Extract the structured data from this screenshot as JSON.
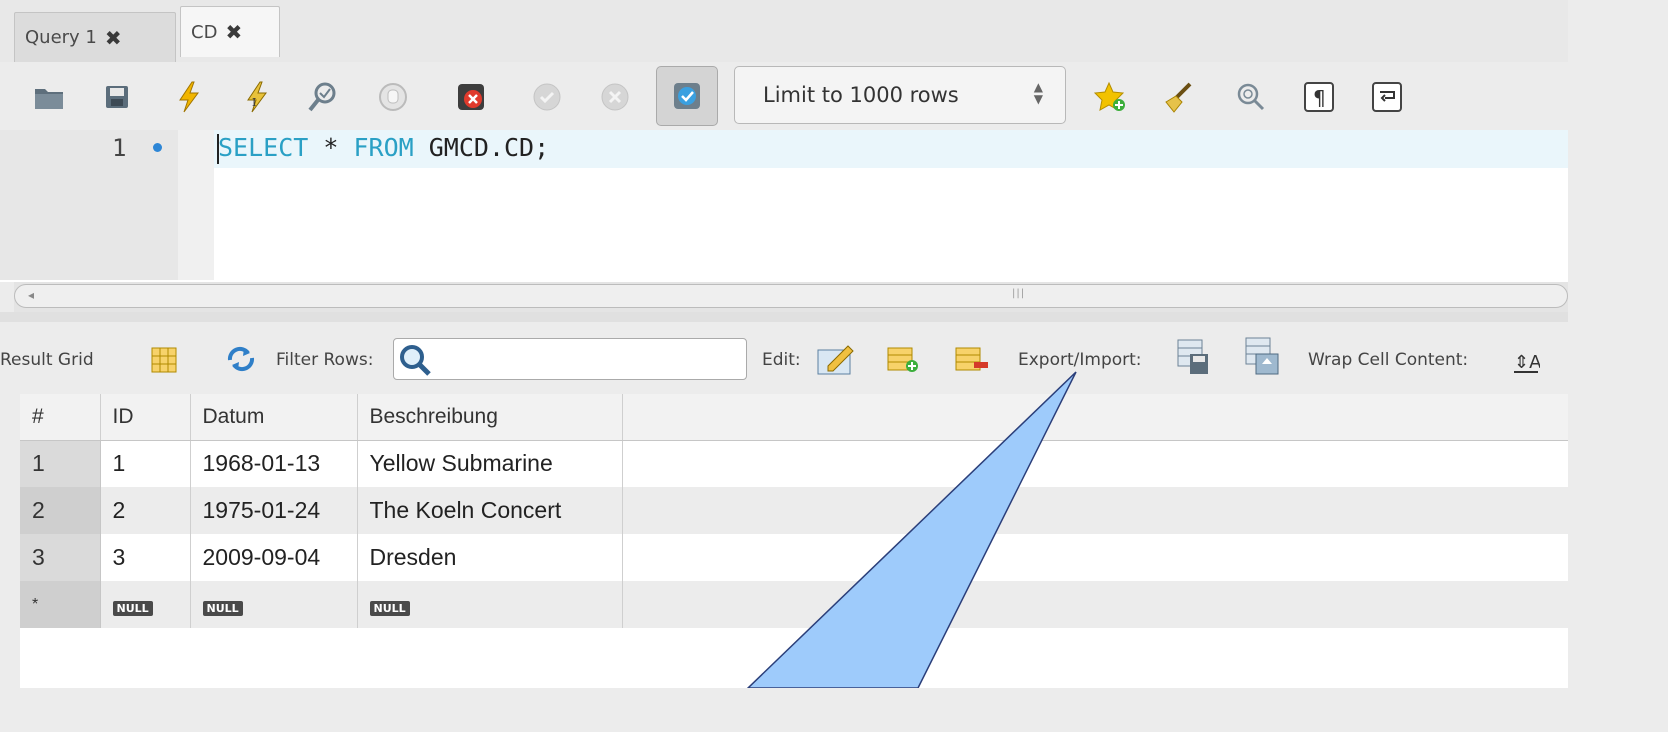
{
  "tabs": [
    {
      "label": "Query 1",
      "close": "✖",
      "active": false
    },
    {
      "label": "CD",
      "close": "✖",
      "active": true
    }
  ],
  "toolbar": {
    "icons": [
      "open-folder-icon",
      "save-icon",
      "execute-icon",
      "execute-current-icon",
      "explain-icon",
      "stop-icon",
      "toggle-error-icon",
      "commit-icon",
      "rollback-icon",
      "autocommit-icon"
    ],
    "limit_label": "Limit to 1000 rows",
    "right_icons": [
      "add-snippet-icon",
      "beautify-icon",
      "find-icon",
      "invisible-chars-icon",
      "wrap-lines-icon"
    ]
  },
  "editor": {
    "line_number": "1",
    "keyword1": "SELECT",
    "star": " * ",
    "keyword2": "FROM",
    "rest": " GMCD.CD;"
  },
  "result_toolbar": {
    "result_grid": "Result Grid",
    "filter_rows": "Filter Rows:",
    "filter_value": "",
    "edit": "Edit:",
    "export_import": "Export/Import:",
    "wrap_cell": "Wrap Cell Content:"
  },
  "grid": {
    "headers": [
      "#",
      "ID",
      "Datum",
      "Beschreibung"
    ],
    "rows": [
      [
        "1",
        "1",
        "1968-01-13",
        "Yellow Submarine"
      ],
      [
        "2",
        "2",
        "1975-01-24",
        "The Koeln Concert"
      ],
      [
        "3",
        "3",
        "2009-09-04",
        "Dresden"
      ]
    ],
    "new_row_marker": "*",
    "null_label": "NULL"
  },
  "colors": {
    "keyword": "#2aa0c5",
    "callout_fill": "#9ecbfb",
    "callout_stroke": "#2b3f7a"
  }
}
